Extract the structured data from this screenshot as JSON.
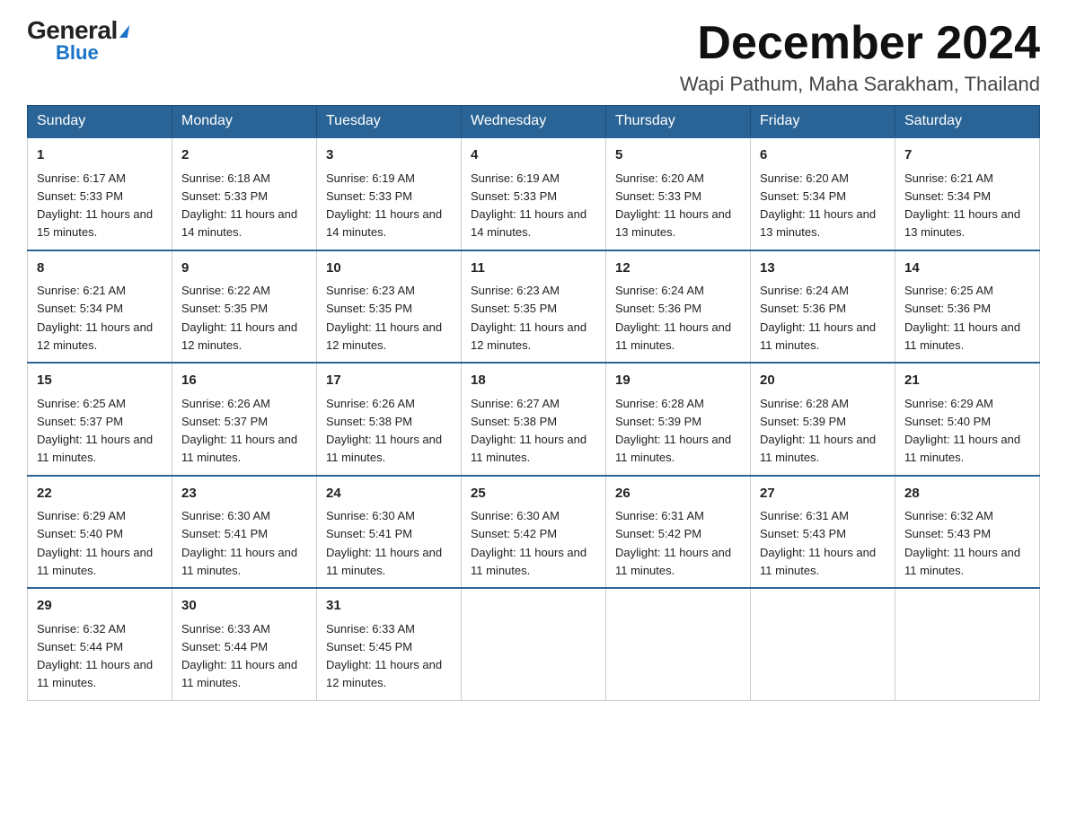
{
  "header": {
    "logo_general": "General",
    "logo_triangle": "",
    "logo_blue": "Blue",
    "month_title": "December 2024",
    "location": "Wapi Pathum, Maha Sarakham, Thailand"
  },
  "weekdays": [
    "Sunday",
    "Monday",
    "Tuesday",
    "Wednesday",
    "Thursday",
    "Friday",
    "Saturday"
  ],
  "weeks": [
    [
      {
        "day": "1",
        "sunrise": "6:17 AM",
        "sunset": "5:33 PM",
        "daylight": "11 hours and 15 minutes."
      },
      {
        "day": "2",
        "sunrise": "6:18 AM",
        "sunset": "5:33 PM",
        "daylight": "11 hours and 14 minutes."
      },
      {
        "day": "3",
        "sunrise": "6:19 AM",
        "sunset": "5:33 PM",
        "daylight": "11 hours and 14 minutes."
      },
      {
        "day": "4",
        "sunrise": "6:19 AM",
        "sunset": "5:33 PM",
        "daylight": "11 hours and 14 minutes."
      },
      {
        "day": "5",
        "sunrise": "6:20 AM",
        "sunset": "5:33 PM",
        "daylight": "11 hours and 13 minutes."
      },
      {
        "day": "6",
        "sunrise": "6:20 AM",
        "sunset": "5:34 PM",
        "daylight": "11 hours and 13 minutes."
      },
      {
        "day": "7",
        "sunrise": "6:21 AM",
        "sunset": "5:34 PM",
        "daylight": "11 hours and 13 minutes."
      }
    ],
    [
      {
        "day": "8",
        "sunrise": "6:21 AM",
        "sunset": "5:34 PM",
        "daylight": "11 hours and 12 minutes."
      },
      {
        "day": "9",
        "sunrise": "6:22 AM",
        "sunset": "5:35 PM",
        "daylight": "11 hours and 12 minutes."
      },
      {
        "day": "10",
        "sunrise": "6:23 AM",
        "sunset": "5:35 PM",
        "daylight": "11 hours and 12 minutes."
      },
      {
        "day": "11",
        "sunrise": "6:23 AM",
        "sunset": "5:35 PM",
        "daylight": "11 hours and 12 minutes."
      },
      {
        "day": "12",
        "sunrise": "6:24 AM",
        "sunset": "5:36 PM",
        "daylight": "11 hours and 11 minutes."
      },
      {
        "day": "13",
        "sunrise": "6:24 AM",
        "sunset": "5:36 PM",
        "daylight": "11 hours and 11 minutes."
      },
      {
        "day": "14",
        "sunrise": "6:25 AM",
        "sunset": "5:36 PM",
        "daylight": "11 hours and 11 minutes."
      }
    ],
    [
      {
        "day": "15",
        "sunrise": "6:25 AM",
        "sunset": "5:37 PM",
        "daylight": "11 hours and 11 minutes."
      },
      {
        "day": "16",
        "sunrise": "6:26 AM",
        "sunset": "5:37 PM",
        "daylight": "11 hours and 11 minutes."
      },
      {
        "day": "17",
        "sunrise": "6:26 AM",
        "sunset": "5:38 PM",
        "daylight": "11 hours and 11 minutes."
      },
      {
        "day": "18",
        "sunrise": "6:27 AM",
        "sunset": "5:38 PM",
        "daylight": "11 hours and 11 minutes."
      },
      {
        "day": "19",
        "sunrise": "6:28 AM",
        "sunset": "5:39 PM",
        "daylight": "11 hours and 11 minutes."
      },
      {
        "day": "20",
        "sunrise": "6:28 AM",
        "sunset": "5:39 PM",
        "daylight": "11 hours and 11 minutes."
      },
      {
        "day": "21",
        "sunrise": "6:29 AM",
        "sunset": "5:40 PM",
        "daylight": "11 hours and 11 minutes."
      }
    ],
    [
      {
        "day": "22",
        "sunrise": "6:29 AM",
        "sunset": "5:40 PM",
        "daylight": "11 hours and 11 minutes."
      },
      {
        "day": "23",
        "sunrise": "6:30 AM",
        "sunset": "5:41 PM",
        "daylight": "11 hours and 11 minutes."
      },
      {
        "day": "24",
        "sunrise": "6:30 AM",
        "sunset": "5:41 PM",
        "daylight": "11 hours and 11 minutes."
      },
      {
        "day": "25",
        "sunrise": "6:30 AM",
        "sunset": "5:42 PM",
        "daylight": "11 hours and 11 minutes."
      },
      {
        "day": "26",
        "sunrise": "6:31 AM",
        "sunset": "5:42 PM",
        "daylight": "11 hours and 11 minutes."
      },
      {
        "day": "27",
        "sunrise": "6:31 AM",
        "sunset": "5:43 PM",
        "daylight": "11 hours and 11 minutes."
      },
      {
        "day": "28",
        "sunrise": "6:32 AM",
        "sunset": "5:43 PM",
        "daylight": "11 hours and 11 minutes."
      }
    ],
    [
      {
        "day": "29",
        "sunrise": "6:32 AM",
        "sunset": "5:44 PM",
        "daylight": "11 hours and 11 minutes."
      },
      {
        "day": "30",
        "sunrise": "6:33 AM",
        "sunset": "5:44 PM",
        "daylight": "11 hours and 11 minutes."
      },
      {
        "day": "31",
        "sunrise": "6:33 AM",
        "sunset": "5:45 PM",
        "daylight": "11 hours and 12 minutes."
      },
      null,
      null,
      null,
      null
    ]
  ],
  "labels": {
    "sunrise": "Sunrise:",
    "sunset": "Sunset:",
    "daylight": "Daylight:"
  }
}
